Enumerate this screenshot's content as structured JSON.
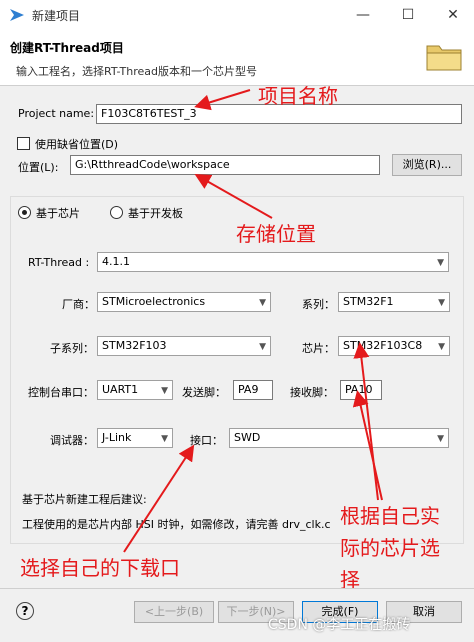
{
  "window": {
    "title": "新建项目",
    "minimize": "—",
    "maximize": "☐",
    "close": "✕"
  },
  "header": {
    "title": "创建RT-Thread项目",
    "description": "输入工程名，选择RT-Thread版本和一个芯片型号"
  },
  "project_name": {
    "label": "Project name:",
    "value": "F103C8T6TEST_3"
  },
  "use_default": {
    "label": "使用缺省位置(D)",
    "checked": false
  },
  "location": {
    "label": "位置(L):",
    "value": "G:\\RtthreadCode\\workspace",
    "browse_label": "浏览(R)..."
  },
  "mode": {
    "chip_label": "基于芯片",
    "board_label": "基于开发板",
    "selected": "chip"
  },
  "fields": {
    "rtthread": {
      "label": "RT-Thread :",
      "value": "4.1.1"
    },
    "vendor": {
      "label": "厂商：",
      "value": "STMicroelectronics"
    },
    "series": {
      "label": "系列：",
      "value": "STM32F1"
    },
    "subseries": {
      "label": "子系列：",
      "value": "STM32F103"
    },
    "chip": {
      "label": "芯片：",
      "value": "STM32F103C8"
    },
    "console_port": {
      "label": "控制台串口：",
      "value": "UART1"
    },
    "tx_pin": {
      "label": "发送脚：",
      "value": "PA9"
    },
    "rx_pin": {
      "label": "接收脚：",
      "value": "PA10"
    },
    "debugger": {
      "label": "调试器：",
      "value": "J-Link"
    },
    "interface": {
      "label": "接口：",
      "value": "SWD"
    }
  },
  "advice": {
    "title": "基于芯片新建工程后建议:",
    "text": "工程使用的是芯片内部 HSI 时钟，如需修改，请完善 drv_clk.c"
  },
  "annotations": {
    "project_name": "项目名称",
    "location": "存储位置",
    "chip_line1": "根据自己实",
    "chip_line2": "际的芯片选",
    "chip_line3": "择",
    "interface": "选择自己的下载口"
  },
  "footer": {
    "help": "?",
    "back": "<上一步(B)",
    "next": "下一步(N)>",
    "finish": "完成(F)",
    "cancel": "取消"
  },
  "watermark": "CSDN @李工正在搬砖",
  "colors": {
    "annotation": "#e41a1c",
    "accent": "#0078d7"
  }
}
